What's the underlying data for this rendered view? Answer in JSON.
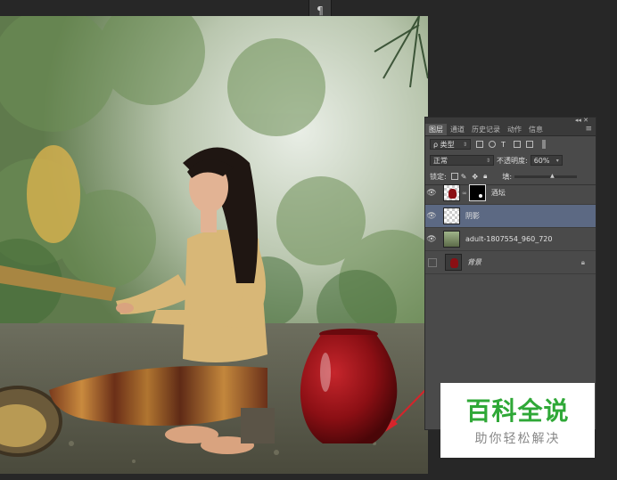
{
  "top_tab": {
    "icon": "¶"
  },
  "panel": {
    "tabs": [
      {
        "label": "图层",
        "active": true
      },
      {
        "label": "通道",
        "active": false
      },
      {
        "label": "历史记录",
        "active": false
      },
      {
        "label": "动作",
        "active": false
      },
      {
        "label": "信息",
        "active": false
      }
    ],
    "menu_icon": "≡",
    "filter": {
      "value": "ρ 类型"
    },
    "blend": {
      "value": "正常",
      "opacity_label": "不透明度:",
      "opacity_value": "60%"
    },
    "lock_label": "锁定:",
    "fill_label": "填:",
    "layers": [
      {
        "name": "酒坛",
        "visible": true,
        "has_mask": true
      },
      {
        "name": "阴影",
        "visible": true,
        "selected": true
      },
      {
        "name": "adult-1807554_960_720",
        "visible": true
      },
      {
        "name": "背景",
        "visible": false,
        "locked": true
      }
    ]
  },
  "watermark": {
    "title": "百科全说",
    "subtitle": "助你轻松解决"
  },
  "colors": {
    "jar": "#8b0f14",
    "arrow": "#d6242b",
    "selected_layer": "#5c6983",
    "watermark_green": "#2fa837"
  }
}
